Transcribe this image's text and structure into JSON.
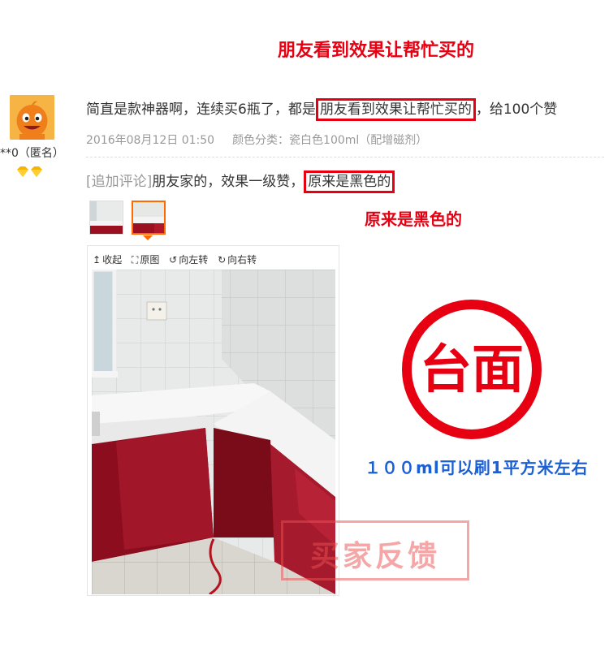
{
  "top_caption": "朋友看到效果让帮忙买的",
  "user": {
    "name": "**0（匿名）",
    "level_icon": "diamond-icon"
  },
  "review": {
    "text_before": "简直是款神器啊，连续买6瓶了，都是",
    "highlight": "朋友看到效果让帮忙买的",
    "text_after": "，给100个赞"
  },
  "meta": {
    "datetime": "2016年08月12日 01:50",
    "sku": "颜色分类：瓷白色100ml（配增磁剂）"
  },
  "append": {
    "tag": "[追加评论]",
    "text": "朋友家的，效果一级赞，",
    "highlight": "原来是黑色的"
  },
  "mid_caption": "原来是黑色的",
  "viewer": {
    "toolbar": [
      {
        "icon": "collapse-icon",
        "glyph": "↥",
        "label": "收起"
      },
      {
        "icon": "fullsize-icon",
        "glyph": "⛶",
        "label": "原图"
      },
      {
        "icon": "rotate-left-icon",
        "glyph": "↺",
        "label": "向左转"
      },
      {
        "icon": "rotate-right-icon",
        "glyph": "↻",
        "label": "向右转"
      }
    ]
  },
  "stamp_text": "台面",
  "coverage_note": "１００ml可以刷1平方米左右",
  "watermark_text": "买家反馈",
  "colors": {
    "accent_red": "#e60012",
    "coverage_blue": "#1a5fd4",
    "thumb_active": "#ff6a00",
    "meta_gray": "#999999"
  }
}
